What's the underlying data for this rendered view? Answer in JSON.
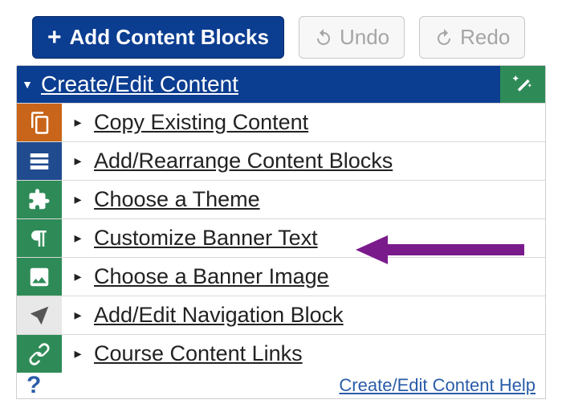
{
  "toolbar": {
    "add_label": "Add Content Blocks",
    "undo_label": "Undo",
    "redo_label": "Redo"
  },
  "panel": {
    "title": "Create/Edit Content"
  },
  "items": [
    {
      "label": "Copy Existing Content",
      "icon": "copy",
      "color": "orange"
    },
    {
      "label": "Add/Rearrange Content Blocks",
      "icon": "list",
      "color": "blue"
    },
    {
      "label": "Choose a Theme",
      "icon": "puzzle",
      "color": "green"
    },
    {
      "label": "Customize Banner Text",
      "icon": "pilcrow",
      "color": "green"
    },
    {
      "label": "Choose a Banner Image",
      "icon": "image",
      "color": "green"
    },
    {
      "label": "Add/Edit Navigation Block",
      "icon": "nav",
      "color": "gray"
    },
    {
      "label": "Course Content Links",
      "icon": "link",
      "color": "green"
    }
  ],
  "footer": {
    "help": "Create/Edit Content Help"
  },
  "annotation": {
    "arrow_color": "#7a1b8c",
    "target_index": 3
  }
}
